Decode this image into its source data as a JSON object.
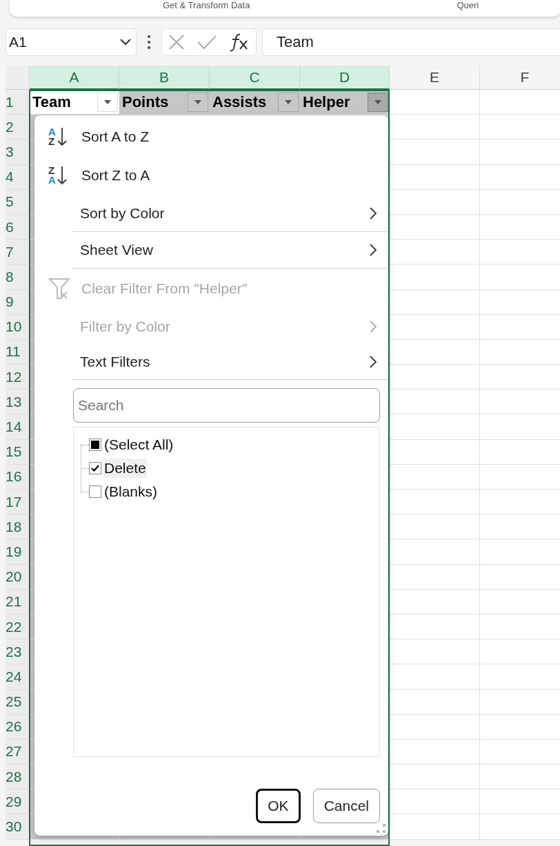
{
  "ribbon": {
    "groups": [
      "Get & Transform Data",
      "Queri"
    ]
  },
  "formula_bar": {
    "name_box": "A1",
    "formula": "Team"
  },
  "columns": [
    {
      "label": "A",
      "selected": true
    },
    {
      "label": "B",
      "selected": true
    },
    {
      "label": "C",
      "selected": true
    },
    {
      "label": "D",
      "selected": true
    },
    {
      "label": "E",
      "selected": false
    },
    {
      "label": "F",
      "selected": false
    }
  ],
  "rows": [
    "1",
    "2",
    "3",
    "4",
    "5",
    "6",
    "7",
    "8",
    "9",
    "10",
    "11",
    "12",
    "13",
    "14",
    "15",
    "16",
    "17",
    "18",
    "19",
    "20",
    "21",
    "22",
    "23",
    "24",
    "25",
    "26",
    "27",
    "28",
    "29",
    "30"
  ],
  "header_cells": [
    {
      "text": "Team",
      "active": true,
      "filter_open": false
    },
    {
      "text": "Points",
      "active": false,
      "filter_open": false
    },
    {
      "text": "Assists",
      "active": false,
      "filter_open": false
    },
    {
      "text": "Helper",
      "active": false,
      "filter_open": true
    }
  ],
  "filter_menu": {
    "items": [
      {
        "kind": "sort",
        "label": "Sort A to Z",
        "icon": {
          "top": "A",
          "bottom": "Z",
          "top_blue": true
        },
        "disabled": false,
        "submenu": false,
        "separator_after": false
      },
      {
        "kind": "sort",
        "label": "Sort Z to A",
        "icon": {
          "top": "Z",
          "bottom": "A",
          "top_blue": false
        },
        "disabled": false,
        "submenu": false,
        "separator_after": false
      },
      {
        "kind": "plain",
        "label": "Sort by Color",
        "disabled": false,
        "submenu": true,
        "separator_after": true
      },
      {
        "kind": "plain",
        "label": "Sheet View",
        "disabled": false,
        "submenu": true,
        "separator_after": true
      },
      {
        "kind": "clear",
        "label": "Clear Filter From \"Helper\"",
        "disabled": true,
        "submenu": false,
        "separator_after": false
      },
      {
        "kind": "plain",
        "label": "Filter by Color",
        "disabled": true,
        "submenu": true,
        "separator_after": false
      },
      {
        "kind": "plain",
        "label": "Text Filters",
        "disabled": false,
        "submenu": true,
        "separator_after": true
      }
    ],
    "search": {
      "placeholder": "Search"
    },
    "values": [
      {
        "label": "(Select All)",
        "checked": false,
        "indeterminate": true,
        "selected": false
      },
      {
        "label": "Delete",
        "checked": true,
        "indeterminate": false,
        "selected": true
      },
      {
        "label": "(Blanks)",
        "checked": false,
        "indeterminate": false,
        "selected": false
      }
    ],
    "buttons": [
      {
        "label": "OK",
        "default": true
      },
      {
        "label": "Cancel",
        "default": false
      }
    ]
  }
}
